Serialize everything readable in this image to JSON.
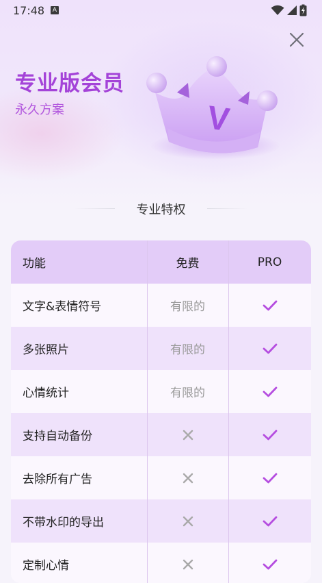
{
  "status_bar": {
    "time": "17:48",
    "notif_badge": "A"
  },
  "header": {
    "title": "专业版会员",
    "subtitle": "永久方案",
    "badge_letter": "V"
  },
  "section_title": "专业特权",
  "table": {
    "headers": [
      "功能",
      "免费",
      "PRO"
    ],
    "rows": [
      {
        "feature": "文字&表情符号",
        "free": "有限的",
        "pro": "check"
      },
      {
        "feature": "多张照片",
        "free": "有限的",
        "pro": "check"
      },
      {
        "feature": "心情统计",
        "free": "有限的",
        "pro": "check"
      },
      {
        "feature": "支持自动备份",
        "free": "cross",
        "pro": "check"
      },
      {
        "feature": "去除所有广告",
        "free": "cross",
        "pro": "check"
      },
      {
        "feature": "不带水印的导出",
        "free": "cross",
        "pro": "check"
      },
      {
        "feature": "定制心情",
        "free": "cross",
        "pro": "check"
      }
    ]
  },
  "colors": {
    "accent": "#a443d8",
    "check": "#b54de0",
    "cross": "#a9a9a9"
  }
}
